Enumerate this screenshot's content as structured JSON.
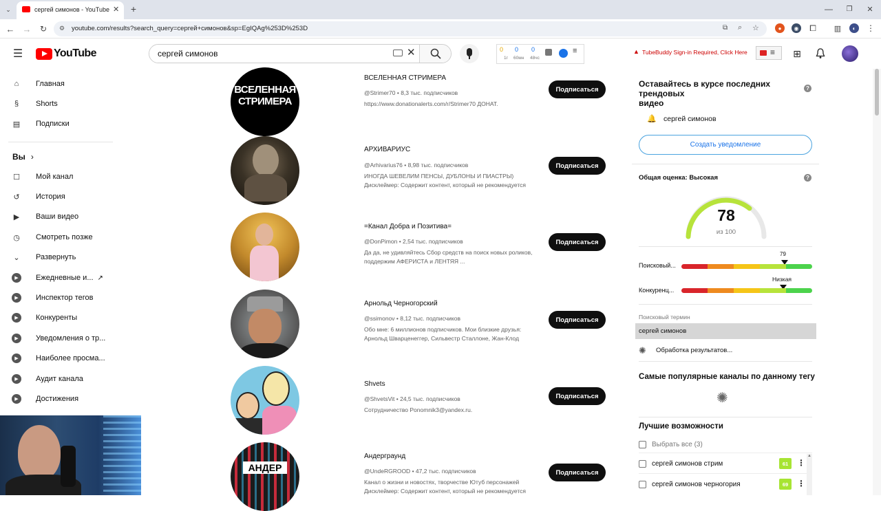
{
  "browser": {
    "tab_title": "сергей симонов - YouTube",
    "url": "youtube.com/results?search_query=сергей+симонов&sp=EgIQAg%253D%253D"
  },
  "header": {
    "logo_text": "YouTube",
    "search_value": "сергей симонов",
    "stats": [
      {
        "value": "0",
        "label": "1г"
      },
      {
        "value": "0",
        "label": "60мн"
      },
      {
        "value": "0",
        "label": "48чс"
      }
    ],
    "tubebuddy_warning": "TubeBuddy Sign-in Required, Click Here"
  },
  "sidebar": {
    "main": [
      {
        "label": "Главная",
        "icon": "home-icon"
      },
      {
        "label": "Shorts",
        "icon": "shorts-icon"
      },
      {
        "label": "Подписки",
        "icon": "subscriptions-icon"
      }
    ],
    "you_label": "Вы",
    "you_items": [
      {
        "label": "Мой канал",
        "icon": "channel-icon"
      },
      {
        "label": "История",
        "icon": "history-icon"
      },
      {
        "label": "Ваши видео",
        "icon": "video-icon"
      },
      {
        "label": "Смотреть позже",
        "icon": "clock-icon"
      },
      {
        "label": "Развернуть",
        "icon": "chevron-down-icon"
      }
    ],
    "extra_items": [
      {
        "label": "Ежедневные и..."
      },
      {
        "label": "Инспектор тегов"
      },
      {
        "label": "Конкуренты"
      },
      {
        "label": "Уведомления о тр..."
      },
      {
        "label": "Наиболее просма..."
      },
      {
        "label": "Аудит канала"
      },
      {
        "label": "Достижения"
      }
    ]
  },
  "results": [
    {
      "name": "ВСЕЛЕННАЯ СТРИМЕРА",
      "handle": "@Strimer70",
      "subs": "8,3 тыс. подписчиков",
      "desc1": "https://www.donationalerts.com/r/Strimer70 ДОНАТ.",
      "desc2": "",
      "avatar_text": "ВСЕЛЕННАЯ СТРИМЕРА"
    },
    {
      "name": "АРХИВАРИУС",
      "handle": "@Arhivarius76",
      "subs": "8,98 тыс. подписчиков",
      "desc1": "ИНОГДА ШЕВЕЛИМ ПЕНСЫ, ДУБЛОНЫ И ПИАСТРЫ)",
      "desc2": "Дисклеймер: Содержит контент, который не рекомендуется",
      "avatar_text": ""
    },
    {
      "name": "=Канал Добра и Позитива=",
      "handle": "@DonPimon",
      "subs": "2,54 тыс. подписчиков",
      "desc1": "Да да, не удивляйтесь Сбор средств на поиск новых роликов,",
      "desc2": "поддержим АФЕРИСТА и ЛЕНТЯЯ ...",
      "avatar_text": ""
    },
    {
      "name": "Арнольд Черногорский",
      "handle": "@ssimonov",
      "subs": "8,12 тыс. подписчиков",
      "desc1": "Обо мне: 6 миллионов подписчиков. Мои близкие друзья:",
      "desc2": "Арнольд Шварценеггер, Сильвестр Сталлоне, Жан-Клод",
      "avatar_text": ""
    },
    {
      "name": "Shvets",
      "handle": "@ShvetsVit",
      "subs": "24,5 тыс. подписчиков",
      "desc1": "Сотрудничество Ponomnik3@yandex.ru.",
      "desc2": "",
      "avatar_text": ""
    },
    {
      "name": "Андерграунд",
      "handle": "@UndeRGROOD",
      "subs": "47,2 тыс. подписчиков",
      "desc1": "Канал о жизни и новостях, творчестве Ютуб персонажей",
      "desc2": "Дисклеймер: Содержит контент, который не рекомендуется",
      "avatar_text": "АНДЕР"
    }
  ],
  "subscribe_label": "Подписаться",
  "tubebuddy": {
    "trend_title_1": "Оставайтесь в курсе последних трендовых",
    "trend_title_2": "видео",
    "trend_query": "сергей симонов",
    "create_alert": "Создать уведомление",
    "overall_label": "Общая оценка: Высокая",
    "score": "78",
    "score_of": "из 100",
    "search_marker": "79",
    "search_label": "Поисковый...",
    "comp_marker": "Низкая",
    "comp_label": "Конкуренц...",
    "search_term_label": "Поисковый термин",
    "search_term_value": "сергей симонов",
    "processing": "Обработка результатов...",
    "popular_channels": "Самые популярные каналы по данному тегу",
    "best_opps": "Лучшие возможности",
    "select_all": "Выбрать все (3)",
    "opportunities": [
      {
        "label": "сергей симонов стрим",
        "score": "61"
      },
      {
        "label": "сергей симонов черногория",
        "score": "69"
      }
    ],
    "colors": {
      "red": "#d9252b",
      "orange": "#ee8a1f",
      "yellow": "#f5c518",
      "lightgreen": "#b7e33b",
      "green": "#4cd34c"
    }
  }
}
